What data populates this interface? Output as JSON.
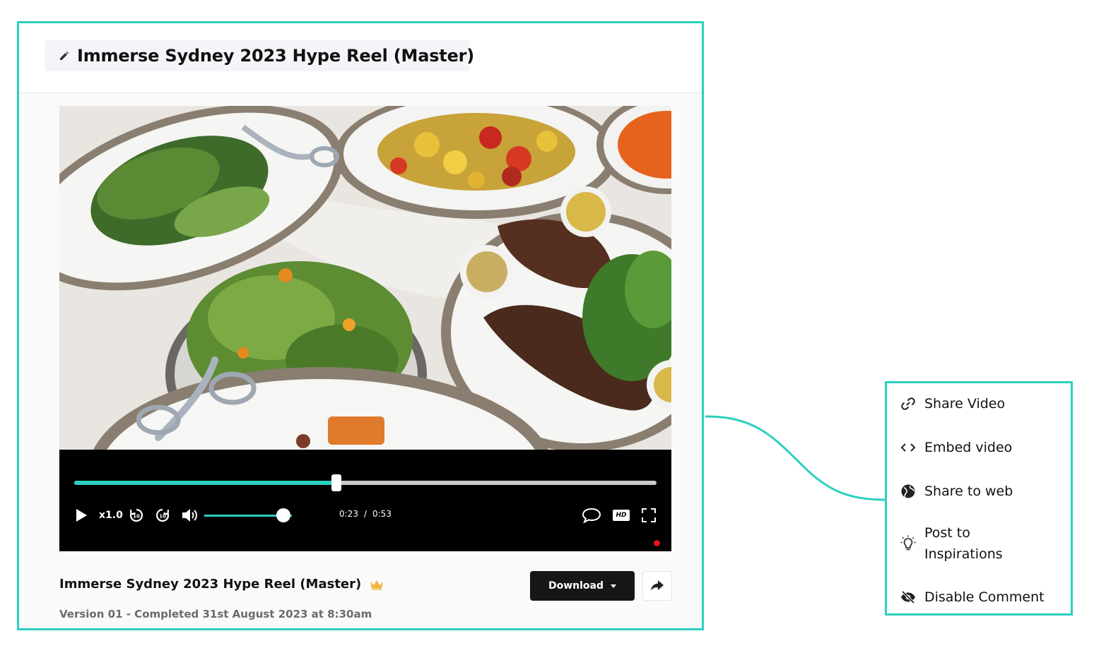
{
  "card": {
    "title": "Immerse Sydney 2023 Hype Reel (Master)"
  },
  "player": {
    "progress": 0.45,
    "volume": 0.9,
    "speed": "x1.0",
    "current_time": "0:23",
    "time_separator": "/",
    "duration": "0:53",
    "skip_back_seconds": "10",
    "skip_forward_seconds": "10",
    "hd_label": "HD"
  },
  "info": {
    "title": "Immerse Sydney 2023 Hype Reel (Master)",
    "meta": "Version 01 - Completed 31st August 2023 at 8:30am"
  },
  "actions": {
    "download_label": "Download"
  },
  "share_menu": {
    "items": [
      {
        "label": "Share Video",
        "icon": "link-icon"
      },
      {
        "label": "Embed video",
        "icon": "code-icon"
      },
      {
        "label": "Share to web",
        "icon": "globe-icon"
      },
      {
        "label": "Post to Inspirations",
        "icon": "lightbulb-icon"
      },
      {
        "label": "Disable Comment",
        "icon": "eye-off-icon"
      }
    ]
  },
  "colors": {
    "accent": "#2ccfbf",
    "record": "#e8101a",
    "crown": "#f2b63c"
  }
}
